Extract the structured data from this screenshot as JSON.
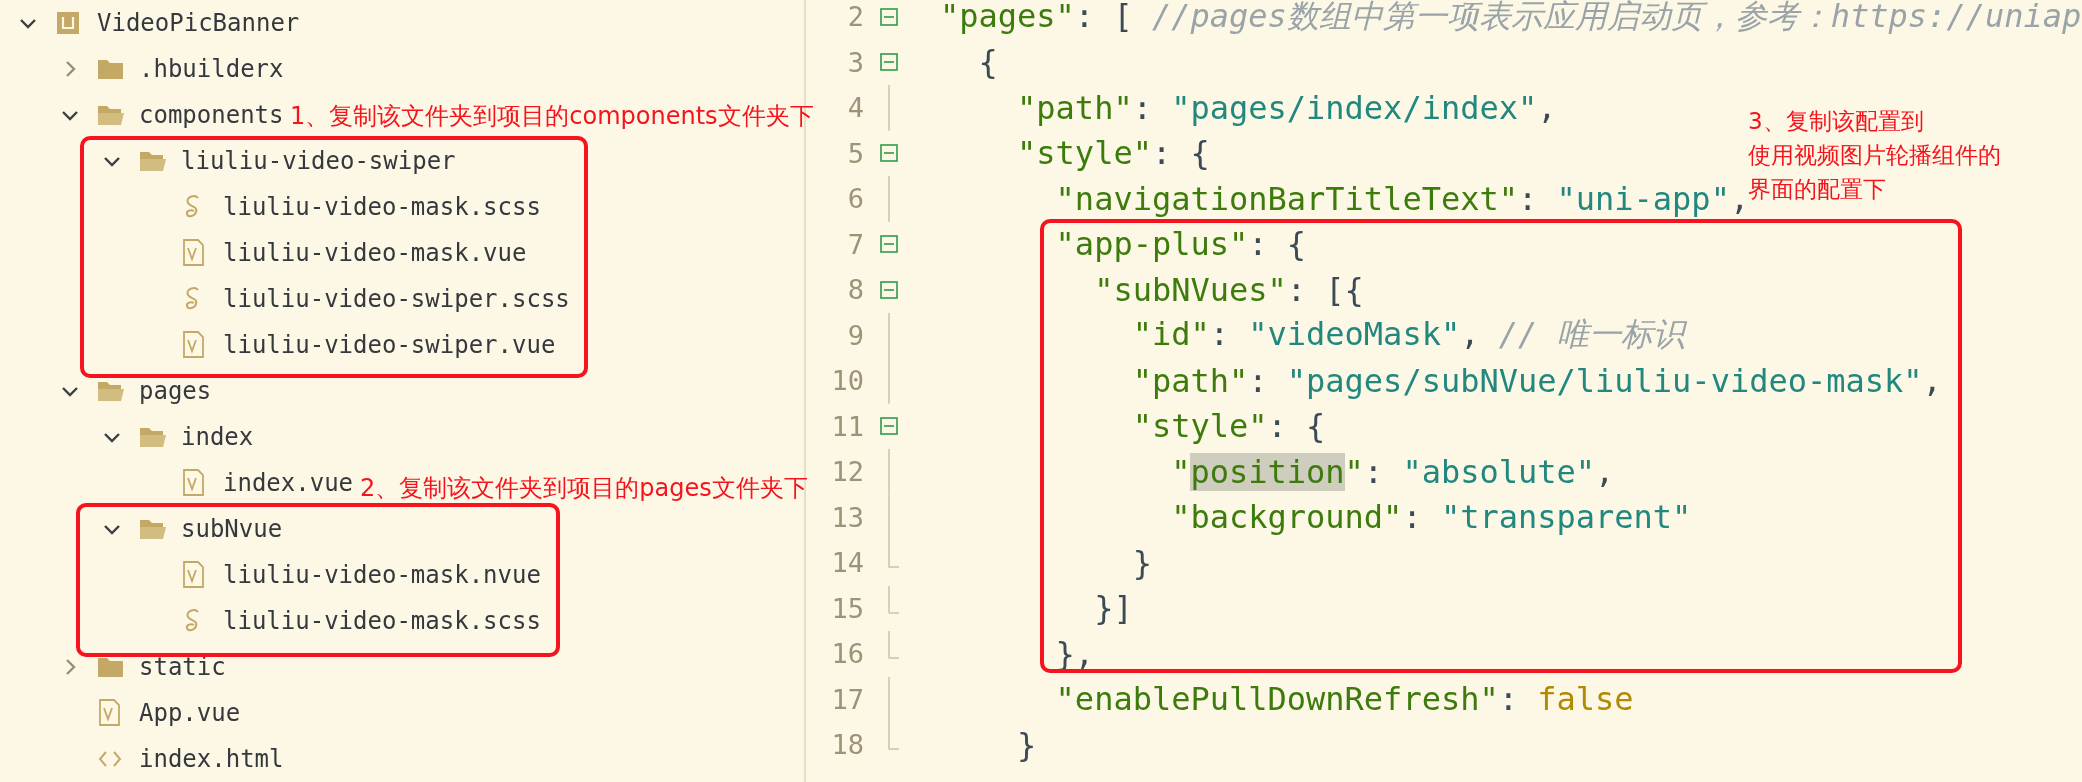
{
  "explorer": {
    "items": [
      {
        "name": "VideoPicBanner",
        "kind": "project",
        "expanded": true,
        "children": [
          {
            "name": ".hbuilderx",
            "kind": "folder",
            "expanded": false
          },
          {
            "name": "components",
            "kind": "folder",
            "expanded": true,
            "children": [
              {
                "name": "liuliu-video-swiper",
                "kind": "folder",
                "expanded": true,
                "children": [
                  {
                    "name": "liuliu-video-mask.scss",
                    "kind": "scss"
                  },
                  {
                    "name": "liuliu-video-mask.vue",
                    "kind": "vue"
                  },
                  {
                    "name": "liuliu-video-swiper.scss",
                    "kind": "scss"
                  },
                  {
                    "name": "liuliu-video-swiper.vue",
                    "kind": "vue"
                  }
                ]
              }
            ]
          },
          {
            "name": "pages",
            "kind": "folder",
            "expanded": true,
            "children": [
              {
                "name": "index",
                "kind": "folder",
                "expanded": true,
                "children": [
                  {
                    "name": "index.vue",
                    "kind": "vue"
                  }
                ]
              },
              {
                "name": "subNvue",
                "kind": "folder",
                "expanded": true,
                "children": [
                  {
                    "name": "liuliu-video-mask.nvue",
                    "kind": "vue"
                  },
                  {
                    "name": "liuliu-video-mask.scss",
                    "kind": "scss"
                  }
                ]
              }
            ]
          },
          {
            "name": "static",
            "kind": "folder",
            "expanded": false
          },
          {
            "name": "App.vue",
            "kind": "vue"
          },
          {
            "name": "index.html",
            "kind": "html"
          }
        ]
      }
    ]
  },
  "editor": {
    "lines": [
      {
        "number": "2",
        "foldable": true,
        "block_end": false,
        "tokens": [
          {
            "kind": "key",
            "text": "\"pages\""
          },
          {
            "kind": "punct",
            "text": ": [ "
          },
          {
            "kind": "comment",
            "text": "//pages数组中第一项表示应用启动页，参考：https://uniap"
          }
        ]
      },
      {
        "number": "3",
        "foldable": true,
        "block_end": false,
        "tokens": [
          {
            "kind": "punct",
            "text": "  {"
          }
        ]
      },
      {
        "number": "4",
        "foldable": false,
        "block_end": false,
        "tokens": [
          {
            "kind": "key",
            "text": "    \"path\""
          },
          {
            "kind": "punct",
            "text": ": "
          },
          {
            "kind": "string",
            "text": "\"pages/index/index\""
          },
          {
            "kind": "punct",
            "text": ","
          }
        ]
      },
      {
        "number": "5",
        "foldable": true,
        "block_end": false,
        "tokens": [
          {
            "kind": "key",
            "text": "    \"style\""
          },
          {
            "kind": "punct",
            "text": ": {"
          }
        ]
      },
      {
        "number": "6",
        "foldable": false,
        "block_end": false,
        "tokens": [
          {
            "kind": "key",
            "text": "      \"navigationBarTitleText\""
          },
          {
            "kind": "punct",
            "text": ": "
          },
          {
            "kind": "string",
            "text": "\"uni-app\""
          },
          {
            "kind": "punct",
            "text": ","
          }
        ]
      },
      {
        "number": "7",
        "foldable": true,
        "block_end": false,
        "tokens": [
          {
            "kind": "key",
            "text": "      \"app-plus\""
          },
          {
            "kind": "punct",
            "text": ": {"
          }
        ]
      },
      {
        "number": "8",
        "foldable": true,
        "block_end": false,
        "tokens": [
          {
            "kind": "key",
            "text": "        \"subNVues\""
          },
          {
            "kind": "punct",
            "text": ": [{"
          }
        ]
      },
      {
        "number": "9",
        "foldable": false,
        "block_end": false,
        "tokens": [
          {
            "kind": "key",
            "text": "          \"id\""
          },
          {
            "kind": "punct",
            "text": ": "
          },
          {
            "kind": "string",
            "text": "\"videoMask\""
          },
          {
            "kind": "punct",
            "text": ", "
          },
          {
            "kind": "comment",
            "text": "// 唯一标识"
          }
        ]
      },
      {
        "number": "10",
        "foldable": false,
        "block_end": false,
        "tokens": [
          {
            "kind": "key",
            "text": "          \"path\""
          },
          {
            "kind": "punct",
            "text": ": "
          },
          {
            "kind": "string",
            "text": "\"pages/subNVue/liuliu-video-mask\""
          },
          {
            "kind": "punct",
            "text": ","
          }
        ]
      },
      {
        "number": "11",
        "foldable": true,
        "block_end": false,
        "tokens": [
          {
            "kind": "key",
            "text": "          \"style\""
          },
          {
            "kind": "punct",
            "text": ": {"
          }
        ]
      },
      {
        "number": "12",
        "foldable": false,
        "block_end": false,
        "tokens": [
          {
            "kind": "key",
            "text": "            \""
          },
          {
            "kind": "match",
            "text": "position"
          },
          {
            "kind": "key",
            "text": "\""
          },
          {
            "kind": "punct",
            "text": ": "
          },
          {
            "kind": "string",
            "text": "\"absolute\""
          },
          {
            "kind": "punct",
            "text": ","
          }
        ]
      },
      {
        "number": "13",
        "foldable": false,
        "block_end": false,
        "tokens": [
          {
            "kind": "key",
            "text": "            \"background\""
          },
          {
            "kind": "punct",
            "text": ": "
          },
          {
            "kind": "string",
            "text": "\"transparent\""
          }
        ]
      },
      {
        "number": "14",
        "foldable": false,
        "block_end": true,
        "tokens": [
          {
            "kind": "punct",
            "text": "          }"
          }
        ]
      },
      {
        "number": "15",
        "foldable": false,
        "block_end": true,
        "tokens": [
          {
            "kind": "punct",
            "text": "        }]"
          }
        ]
      },
      {
        "number": "16",
        "foldable": false,
        "block_end": true,
        "tokens": [
          {
            "kind": "punct",
            "text": "      },"
          }
        ]
      },
      {
        "number": "17",
        "foldable": false,
        "block_end": false,
        "tokens": [
          {
            "kind": "key",
            "text": "      \"enablePullDownRefresh\""
          },
          {
            "kind": "punct",
            "text": ": "
          },
          {
            "kind": "bool",
            "text": "false"
          }
        ]
      },
      {
        "number": "18",
        "foldable": false,
        "block_end": true,
        "tokens": [
          {
            "kind": "punct",
            "text": "    }"
          }
        ]
      }
    ]
  },
  "annotations": [
    {
      "lines": [
        "1、复制该文件夹到项目的components文件夹下"
      ]
    },
    {
      "lines": [
        "2、复制该文件夹到项目的pages文件夹下"
      ]
    },
    {
      "lines": [
        "3、复制该配置到",
        "使用视频图片轮播组件的",
        "界面的配置下"
      ]
    }
  ]
}
